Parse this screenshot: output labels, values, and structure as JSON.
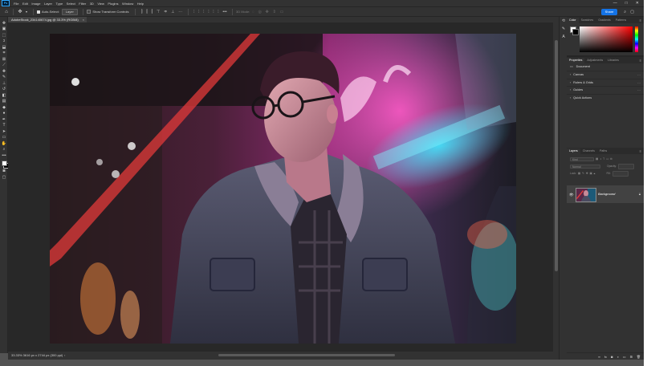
{
  "app": {
    "logo_text": "Ps",
    "menu": [
      "File",
      "Edit",
      "Image",
      "Layer",
      "Type",
      "Select",
      "Filter",
      "3D",
      "View",
      "Plugins",
      "Window",
      "Help"
    ],
    "window_controls": [
      "—",
      "□",
      "✕"
    ]
  },
  "options_bar": {
    "auto_select_label": "Auto-Select:",
    "auto_select_value": "Layer",
    "transform_label": "Show Transform Controls",
    "mode_3d_label": "3D Mode:",
    "share_label": "Share"
  },
  "document": {
    "tab_title": "AdobeStock_234140674.jpg @ 33.3% (RGB/8)",
    "close_glyph": "×",
    "status": "33.33%   3616 px x 2744 px (300 ppi)"
  },
  "color_panel": {
    "tabs": [
      "Color",
      "Swatches",
      "Gradients",
      "Patterns"
    ],
    "foreground": "#ffffff",
    "background": "#000000"
  },
  "properties_panel": {
    "tabs": [
      "Properties",
      "Adjustments",
      "Libraries"
    ],
    "document_label": "Document",
    "sections": [
      "Canvas",
      "Rulers & Grids",
      "Guides",
      "Quick Actions"
    ]
  },
  "layers_panel": {
    "tabs": [
      "Layers",
      "Channels",
      "Paths"
    ],
    "kind_label": "Kind",
    "blend_mode": "Normal",
    "opacity_label": "Opacity:",
    "lock_label": "Lock:",
    "fill_label": "Fill:",
    "layer_name": "Background"
  },
  "colors": {
    "accent": "#1473e6",
    "chrome_dark": "#323232",
    "canvas_bg": "#282828"
  }
}
